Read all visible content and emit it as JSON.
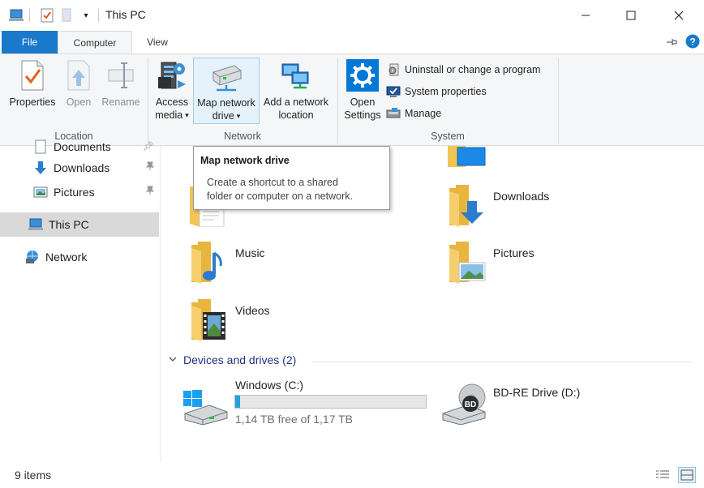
{
  "window": {
    "title": "This PC",
    "controls": [
      "minimize",
      "maximize",
      "close"
    ]
  },
  "ribbon_tabs": [
    {
      "label": "File"
    },
    {
      "label": "Computer"
    },
    {
      "label": "View"
    }
  ],
  "ribbon": {
    "location": {
      "group_label": "Location",
      "properties": "Properties",
      "open": "Open",
      "rename": "Rename"
    },
    "network": {
      "group_label": "Network",
      "access_media_1": "Access",
      "access_media_2": "media",
      "map_network_drive_1": "Map network",
      "map_network_drive_2": "drive",
      "add_network_location_1": "Add a network",
      "add_network_location_2": "location"
    },
    "system": {
      "group_label": "System",
      "open_settings_1": "Open",
      "open_settings_2": "Settings",
      "uninstall": "Uninstall or change a program",
      "system_properties": "System properties",
      "manage": "Manage"
    }
  },
  "tooltip": {
    "title": "Map network drive",
    "line1": "Create a shortcut to a shared",
    "line2": "folder or computer on a network."
  },
  "nav": {
    "items": [
      {
        "label": "Documents",
        "pinned": true
      },
      {
        "label": "Downloads",
        "pinned": true
      },
      {
        "label": "Pictures",
        "pinned": true
      },
      {
        "label": "This PC",
        "selected": true
      },
      {
        "label": "Network"
      }
    ]
  },
  "folders": {
    "downloads": "Downloads",
    "music": "Music",
    "pictures": "Pictures",
    "videos": "Videos"
  },
  "devices": {
    "header": "Devices and drives (2)",
    "drive_c": {
      "name": "Windows (C:)",
      "free_text": "1,14 TB free of 1,17 TB",
      "used_fraction": 0.026
    },
    "drive_d": {
      "name": "BD-RE Drive (D:)",
      "badge": "BD"
    }
  },
  "status": {
    "item_count": "9 items"
  },
  "colors": {
    "accent": "#1979ca",
    "folder": "#f0c556",
    "progress": "#26a0da",
    "selection": "#cce8ff"
  }
}
